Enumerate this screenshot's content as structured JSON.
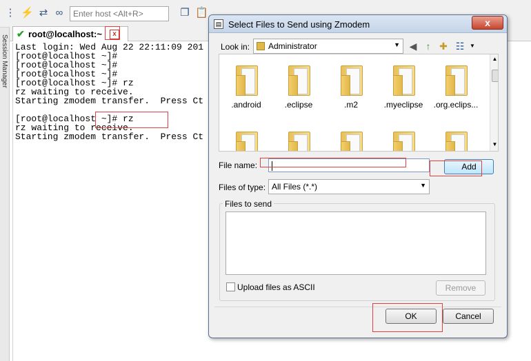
{
  "toolbar": {
    "host_placeholder": "Enter host <Alt+R>",
    "icons": [
      "tree-icon",
      "lightning-icon",
      "reconnect-icon",
      "link-icon",
      "copy-icon",
      "paste-icon",
      "print-icon",
      "settings-icon",
      "save-icon",
      "help-icon",
      "screen-icon"
    ]
  },
  "session_tab": {
    "label": "root@localhost:~",
    "close": "x"
  },
  "side_panel": {
    "label": "Session Manager"
  },
  "terminal": {
    "lines": [
      "Last login: Wed Aug 22 22:11:09 201",
      "[root@localhost ~]#",
      "[root@localhost ~]#",
      "[root@localhost ~]#",
      "[root@localhost ~]# rz",
      "rz waiting to receive.",
      "Starting zmodem transfer.  Press Ct",
      "",
      "[root@localhost ~]# rz",
      "rz waiting to receive.",
      "Starting zmodem transfer.  Press Ct"
    ]
  },
  "dialog": {
    "title": "Select Files to Send using Zmodem",
    "close": "x",
    "look_in_label": "Look in:",
    "look_in_value": "Administrator",
    "files": [
      {
        "name": ".android"
      },
      {
        "name": ".eclipse"
      },
      {
        "name": ".m2"
      },
      {
        "name": ".myeclipse"
      },
      {
        "name": ".org.eclips..."
      }
    ],
    "file_name_label": "File name:",
    "file_name_value": "",
    "add_button": "Add",
    "files_of_type_label": "Files of type:",
    "files_of_type_value": "All Files (*.*)",
    "files_to_send_label": "Files to send",
    "upload_ascii_label": "Upload files as ASCII",
    "remove_button": "Remove",
    "ok_button": "OK",
    "cancel_button": "Cancel"
  }
}
